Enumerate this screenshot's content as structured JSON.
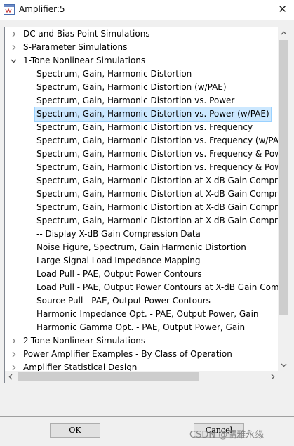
{
  "window": {
    "title": "Amplifier:5",
    "close_glyph": "✕",
    "icon": "ads-schematic-icon"
  },
  "tree": {
    "rows": [
      {
        "label": "DC and Bias Point Simulations",
        "level": 0,
        "state": "collapsed"
      },
      {
        "label": "S-Parameter Simulations",
        "level": 0,
        "state": "collapsed"
      },
      {
        "label": "1-Tone Nonlinear Simulations",
        "level": 0,
        "state": "expanded"
      },
      {
        "label": "Spectrum, Gain, Harmonic Distortion",
        "level": 1,
        "state": "leaf"
      },
      {
        "label": "Spectrum, Gain, Harmonic Distortion (w/PAE)",
        "level": 1,
        "state": "leaf"
      },
      {
        "label": "Spectrum, Gain, Harmonic Distortion vs. Power",
        "level": 1,
        "state": "leaf"
      },
      {
        "label": "Spectrum, Gain, Harmonic Distortion vs. Power (w/PAE)",
        "level": 1,
        "state": "leaf",
        "selected": true
      },
      {
        "label": "Spectrum, Gain, Harmonic Distortion vs. Frequency",
        "level": 1,
        "state": "leaf"
      },
      {
        "label": "Spectrum, Gain, Harmonic Distortion vs. Frequency (w/PAE)",
        "level": 1,
        "state": "leaf"
      },
      {
        "label": "Spectrum, Gain, Harmonic Distortion vs. Frequency & Power",
        "level": 1,
        "state": "leaf"
      },
      {
        "label": "Spectrum, Gain, Harmonic Distortion vs. Frequency & Power",
        "level": 1,
        "state": "leaf"
      },
      {
        "label": "Spectrum, Gain, Harmonic Distortion at X-dB Gain Compres",
        "level": 1,
        "state": "leaf"
      },
      {
        "label": "Spectrum, Gain, Harmonic Distortion at X-dB Gain Compres",
        "level": 1,
        "state": "leaf"
      },
      {
        "label": "Spectrum, Gain, Harmonic Distortion at X-dB Gain Compres",
        "level": 1,
        "state": "leaf"
      },
      {
        "label": "Spectrum, Gain, Harmonic Distortion at X-dB Gain Compres",
        "level": 1,
        "state": "leaf"
      },
      {
        "label": "-- Display X-dB Gain Compression Data",
        "level": 1,
        "state": "leaf"
      },
      {
        "label": "Noise Figure, Spectrum, Gain Harmonic Distortion",
        "level": 1,
        "state": "leaf"
      },
      {
        "label": "Large-Signal Load Impedance Mapping",
        "level": 1,
        "state": "leaf"
      },
      {
        "label": "Load Pull - PAE, Output Power Contours",
        "level": 1,
        "state": "leaf"
      },
      {
        "label": "Load Pull - PAE, Output Power Contours at X-dB Gain Comp",
        "level": 1,
        "state": "leaf"
      },
      {
        "label": "Source Pull - PAE, Output Power Contours",
        "level": 1,
        "state": "leaf"
      },
      {
        "label": "Harmonic Impedance Opt. - PAE, Output Power, Gain",
        "level": 1,
        "state": "leaf"
      },
      {
        "label": "Harmonic Gamma Opt. - PAE, Output Power, Gain",
        "level": 1,
        "state": "leaf"
      },
      {
        "label": "2-Tone Nonlinear Simulations",
        "level": 0,
        "state": "collapsed"
      },
      {
        "label": "Power Amplifier Examples - By Class of Operation",
        "level": 0,
        "state": "collapsed"
      },
      {
        "label": "Amplifier Statistical Design",
        "level": 0,
        "state": "collapsed"
      }
    ],
    "vertical_scroll_fraction": 0.0,
    "horizontal_scroll_fraction": 0.0
  },
  "buttons": {
    "ok_label": "OK",
    "cancel_label": "Cancel"
  },
  "watermark": "CSDN @儒雅永缘",
  "colors": {
    "selection_bg": "#cce8ff",
    "selection_border": "#99d1ff",
    "window_bg": "#f0f0f0"
  }
}
